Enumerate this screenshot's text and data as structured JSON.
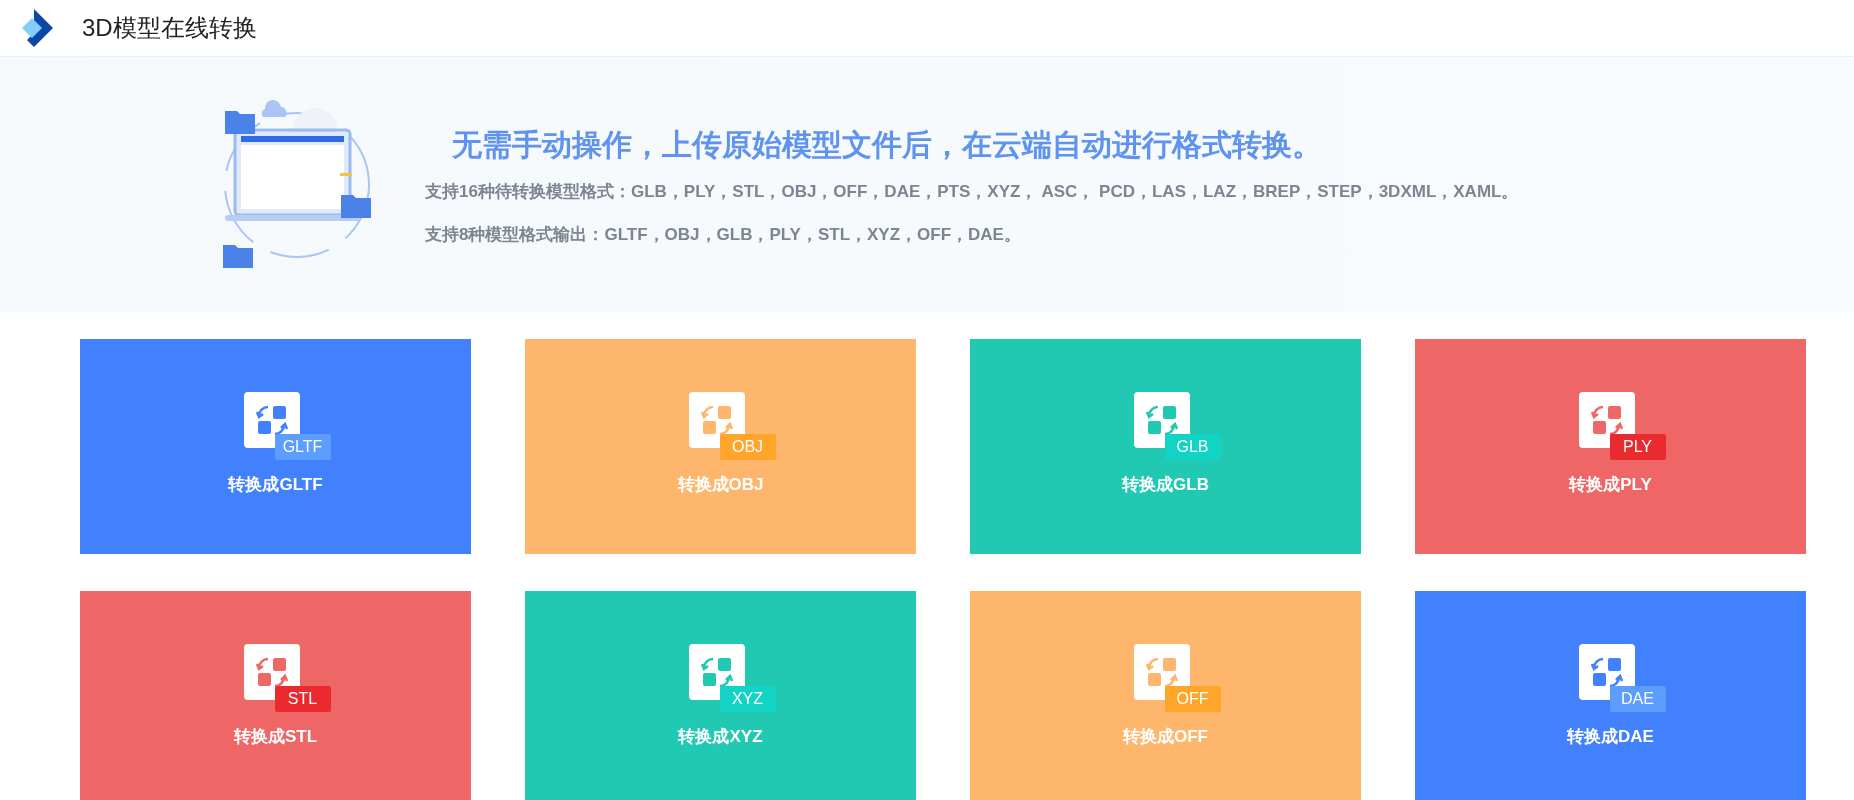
{
  "header": {
    "title": "3D模型在线转换"
  },
  "hero": {
    "headline": "无需手动操作，上传原始模型文件后，在云端自动进行格式转换。",
    "lines": [
      "支持16种待转换模型格式：GLB，PLY，STL，OBJ，OFF，DAE，PTS，XYZ， ASC， PCD，LAS，LAZ，BREP，STEP，3DXML，XAML。",
      "支持8种模型格式输出：GLTF，OBJ，GLB，PLY，STL，XYZ，OFF，DAE。"
    ]
  },
  "cards": [
    {
      "label": "转换成GLTF",
      "tag": "GLTF",
      "color": "#4181fe"
    },
    {
      "label": "转换成OBJ",
      "tag": "OBJ",
      "color": "#fdb66b"
    },
    {
      "label": "转换成GLB",
      "tag": "GLB",
      "color": "#21c9b2"
    },
    {
      "label": "转换成PLY",
      "tag": "PLY",
      "color": "#ef6667"
    },
    {
      "label": "转换成STL",
      "tag": "STL",
      "color": "#ef6667"
    },
    {
      "label": "转换成XYZ",
      "tag": "XYZ",
      "color": "#21c9b2"
    },
    {
      "label": "转换成OFF",
      "tag": "OFF",
      "color": "#fdb66b"
    },
    {
      "label": "转换成DAE",
      "tag": "DAE",
      "color": "#4181fe"
    }
  ]
}
